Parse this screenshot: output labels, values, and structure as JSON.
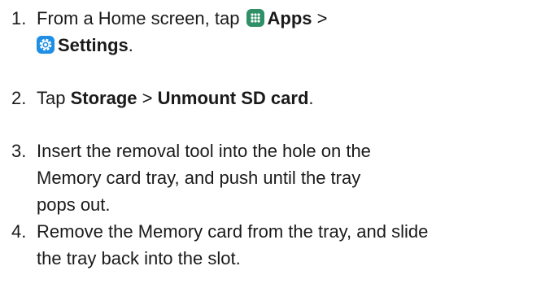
{
  "steps": [
    {
      "number": "1.",
      "text_a": "From a Home screen, tap ",
      "apps_label": "Apps",
      "separator": " >",
      "settings_label": "Settings",
      "end": "."
    },
    {
      "number": "2.",
      "text_a": "Tap ",
      "storage_label": "Storage",
      "separator": " > ",
      "unmount_label": "Unmount SD card",
      "end": "."
    },
    {
      "number": "3.",
      "line1": "Insert the removal tool into the hole on the",
      "line2": "Memory card tray, and push until the tray",
      "line3": "pops out."
    },
    {
      "number": "4.",
      "line1": "Remove the Memory card from the tray, and slide",
      "line2": "the tray back into the slot."
    }
  ],
  "icons": {
    "apps": "apps-grid-icon",
    "settings": "settings-gear-icon",
    "apps_color": "#2f8f66",
    "settings_color": "#1f8fe5"
  }
}
